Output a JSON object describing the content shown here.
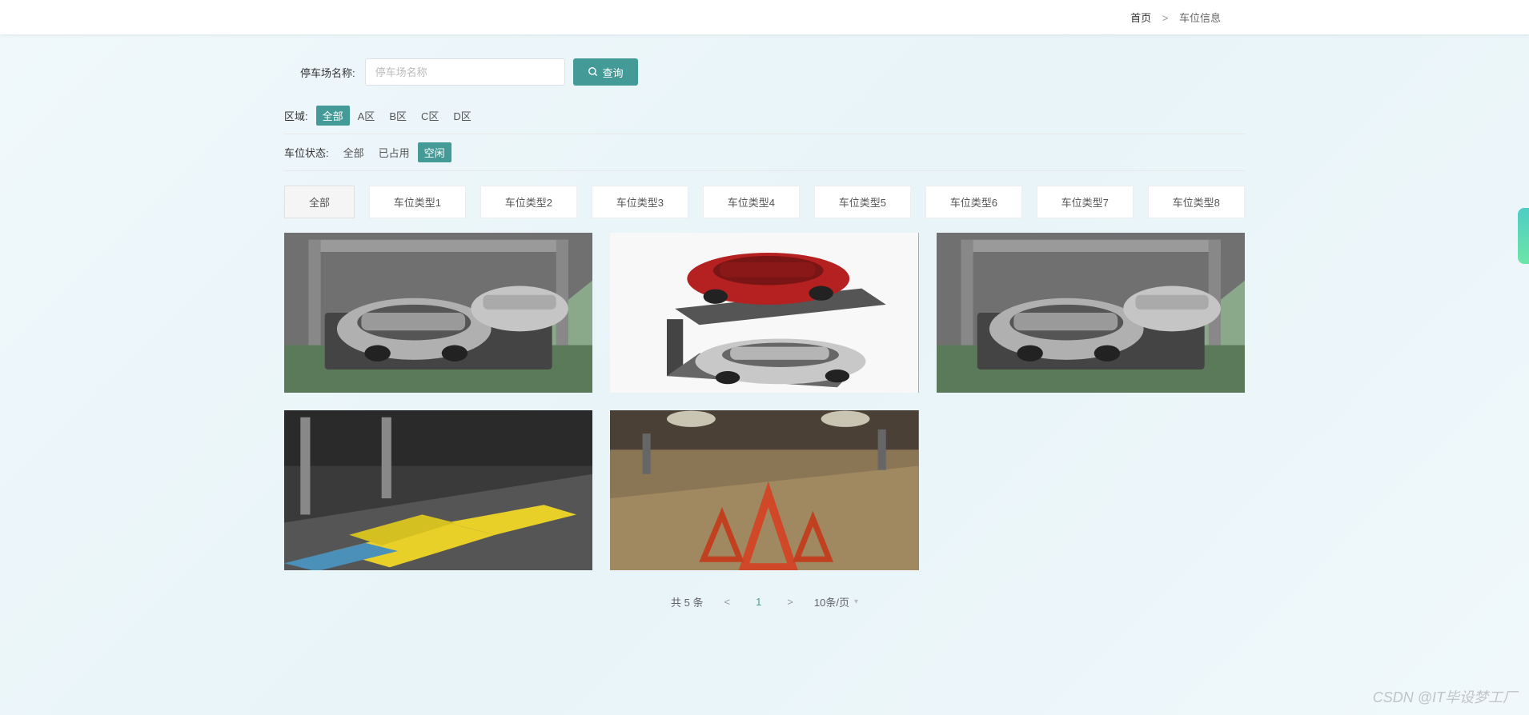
{
  "breadcrumb": {
    "home": "首页",
    "sep": ">",
    "current": "车位信息"
  },
  "search": {
    "label": "停车场名称:",
    "placeholder": "停车场名称",
    "button": "查询"
  },
  "filters": {
    "region": {
      "label": "区域:",
      "options": [
        "全部",
        "A区",
        "B区",
        "C区",
        "D区"
      ],
      "active": 0
    },
    "status": {
      "label": "车位状态:",
      "options": [
        "全部",
        "已占用",
        "空闲"
      ],
      "active": 2
    }
  },
  "tabs": {
    "items": [
      "全部",
      "车位类型1",
      "车位类型2",
      "车位类型3",
      "车位类型4",
      "车位类型5",
      "车位类型6",
      "车位类型7",
      "车位类型8"
    ],
    "active": 0
  },
  "cards": [
    {
      "name": "parking-space-1",
      "type": "mechanical-lift-gray"
    },
    {
      "name": "parking-space-2",
      "type": "stacker-red-silver"
    },
    {
      "name": "parking-space-3",
      "type": "mechanical-lift-gray"
    },
    {
      "name": "parking-space-4",
      "type": "yellow-ramps"
    },
    {
      "name": "parking-space-5",
      "type": "garage-triangle"
    }
  ],
  "pagination": {
    "total": "共 5 条",
    "prev": "<",
    "page": "1",
    "next": ">",
    "pageSize": "10条/页"
  },
  "watermark": "CSDN @IT毕设梦工厂"
}
